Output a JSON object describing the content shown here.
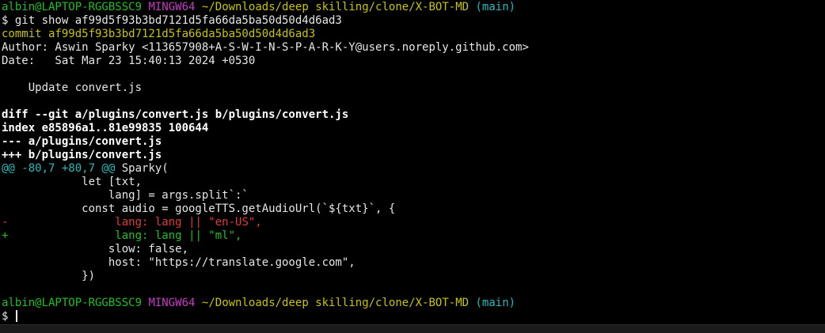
{
  "colors": {
    "background": "#000000",
    "text": "#e6e6e6",
    "user_host": "#1dc121",
    "shell_name": "#c839c5",
    "path": "#c7c400",
    "branch": "#20bbbb",
    "removed": "#e03a3a",
    "added": "#1dc121"
  },
  "prompt1": {
    "user_host": "albin@LAPTOP-RGGBSSC9",
    "shell": "MINGW64",
    "path": "~/Downloads/deep skilling/clone/X-BOT-MD",
    "branch": "(main)"
  },
  "command1": "$ git show af99d5f93b3bd7121d5fa66da5ba50d50d4d6ad3",
  "commit_line": "commit af99d5f93b3bd7121d5fa66da5ba50d50d4d6ad3",
  "author_line": "Author: Aswin Sparky <113657908+A-S-W-I-N-S-P-A-R-K-Y@users.noreply.github.com>",
  "date_line": "Date:   Sat Mar 23 15:40:13 2024 +0530",
  "message_line": "    Update convert.js",
  "diff": {
    "header": "diff --git a/plugins/convert.js b/plugins/convert.js",
    "index": "index e85896a1..81e99835 100644",
    "from_file": "--- a/plugins/convert.js",
    "to_file": "+++ b/plugins/convert.js",
    "hunk_range": "@@ -80,7 +80,7 @@",
    "hunk_context": " Sparky(",
    "ctx1": "            let [txt,",
    "ctx2": "                lang] = args.split`:`",
    "ctx3": "            const audio = googleTTS.getAudioUrl(`${txt}`, {",
    "removed_marker": "-",
    "removed_text": "                lang: lang || \"en-US\",",
    "added_marker": "+",
    "added_text": "                lang: lang || \"ml\",",
    "ctx4": "                slow: false,",
    "ctx5": "                host: \"https://translate.google.com\",",
    "ctx6": "            })"
  },
  "prompt2": {
    "user_host": "albin@LAPTOP-RGGBSSC9",
    "shell": "MINGW64",
    "path": "~/Downloads/deep skilling/clone/X-BOT-MD",
    "branch": "(main)"
  },
  "command2": "$ "
}
